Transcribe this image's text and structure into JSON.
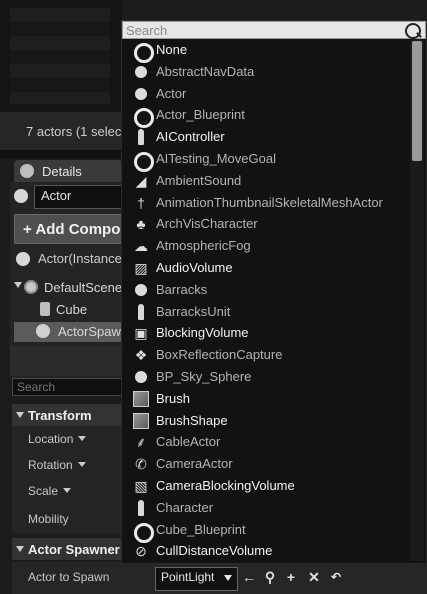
{
  "outliner": {
    "actors_count_text": "7 actors (1 selec"
  },
  "details": {
    "tab_label": "Details",
    "actor_name": "Actor",
    "add_component_label": "+ Add Compo",
    "instance_label": "Actor(Instance",
    "tree": [
      {
        "label": "DefaultScene",
        "icon": "scene-icon"
      },
      {
        "label": "Cube",
        "icon": "cube-icon"
      },
      {
        "label": "ActorSpaw",
        "icon": "actor-spawner-icon"
      }
    ],
    "search_placeholder": "Search",
    "transform": {
      "title": "Transform",
      "rows": [
        "Location",
        "Rotation",
        "Scale",
        "Mobility"
      ]
    },
    "actor_spawner": {
      "title": "Actor Spawner",
      "row_label": "Actor to Spawn",
      "selected_class": "PointLight"
    }
  },
  "popup": {
    "search_placeholder": "Search",
    "items": [
      {
        "label": "None",
        "icon": "ring-icon",
        "style": "bright"
      },
      {
        "label": "AbstractNavData",
        "icon": "dot-icon",
        "style": "dim"
      },
      {
        "label": "Actor",
        "icon": "dot-icon",
        "style": "dim"
      },
      {
        "label": "Actor_Blueprint",
        "icon": "ring-icon",
        "style": "dim"
      },
      {
        "label": "AIController",
        "icon": "pawn-icon",
        "style": "bright"
      },
      {
        "label": "AITesting_MoveGoal",
        "icon": "ring-icon",
        "style": "dim"
      },
      {
        "label": "AmbientSound",
        "icon": "speaker-icon",
        "style": "dim"
      },
      {
        "label": "AnimationThumbnailSkeletalMeshActor",
        "icon": "skeletal-mesh-icon",
        "style": "dim"
      },
      {
        "label": "ArchVisCharacter",
        "icon": "character-icon",
        "style": "dim"
      },
      {
        "label": "AtmosphericFog",
        "icon": "fog-icon",
        "style": "dim"
      },
      {
        "label": "AudioVolume",
        "icon": "audio-volume-icon",
        "style": "bright"
      },
      {
        "label": "Barracks",
        "icon": "dot-icon",
        "style": "dim"
      },
      {
        "label": "BarracksUnit",
        "icon": "pawn-icon",
        "style": "dim"
      },
      {
        "label": "BlockingVolume",
        "icon": "blocking-volume-icon",
        "style": "bright"
      },
      {
        "label": "BoxReflectionCapture",
        "icon": "reflection-capture-icon",
        "style": "dim"
      },
      {
        "label": "BP_Sky_Sphere",
        "icon": "dot-icon",
        "style": "dim"
      },
      {
        "label": "Brush",
        "icon": "brush-cube-icon",
        "style": "bright"
      },
      {
        "label": "BrushShape",
        "icon": "brush-cube-icon",
        "style": "bright"
      },
      {
        "label": "CableActor",
        "icon": "cable-icon",
        "style": "dim"
      },
      {
        "label": "CameraActor",
        "icon": "camera-icon",
        "style": "dim"
      },
      {
        "label": "CameraBlockingVolume",
        "icon": "camera-volume-icon",
        "style": "bright"
      },
      {
        "label": "Character",
        "icon": "pawn-icon",
        "style": "dim"
      },
      {
        "label": "Cube_Blueprint",
        "icon": "ring-icon",
        "style": "dim"
      },
      {
        "label": "CullDistanceVolume",
        "icon": "cull-volume-icon",
        "style": "bright"
      }
    ],
    "scroll_position": 0.0
  }
}
